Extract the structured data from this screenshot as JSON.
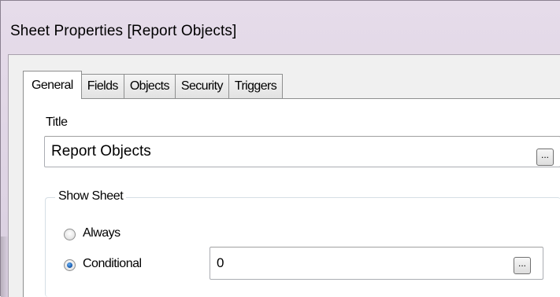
{
  "dialog": {
    "title": "Sheet Properties [Report Objects]"
  },
  "tabs": [
    {
      "label": "General",
      "active": true
    },
    {
      "label": "Fields",
      "active": false
    },
    {
      "label": "Objects",
      "active": false
    },
    {
      "label": "Security",
      "active": false
    },
    {
      "label": "Triggers",
      "active": false
    }
  ],
  "general": {
    "title_label": "Title",
    "title_value": "Report Objects",
    "ellipsis_label": "...",
    "show_sheet": {
      "legend": "Show Sheet",
      "always_label": "Always",
      "always_checked": false,
      "conditional_label": "Conditional",
      "conditional_checked": true,
      "conditional_value": "0",
      "ellipsis_label": "..."
    }
  }
}
